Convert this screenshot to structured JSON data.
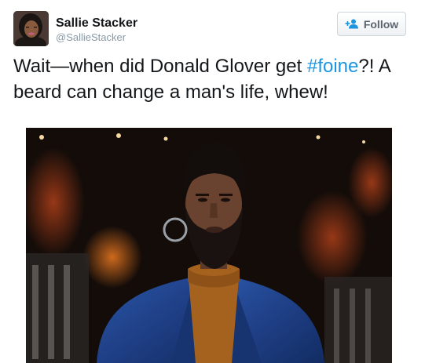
{
  "author": {
    "name": "Sallie Stacker",
    "handle": "@SallieStacker"
  },
  "follow": {
    "label": "Follow",
    "icon": "add-user-icon"
  },
  "tweet": {
    "text_before": "Wait—when did Donald Glover get ",
    "hashtag": "#foine",
    "text_after": "?! A beard can change a man's life, whew!"
  },
  "colors": {
    "hashtag": "#1b95e0",
    "handle": "#8899a6",
    "text": "#14171a"
  }
}
